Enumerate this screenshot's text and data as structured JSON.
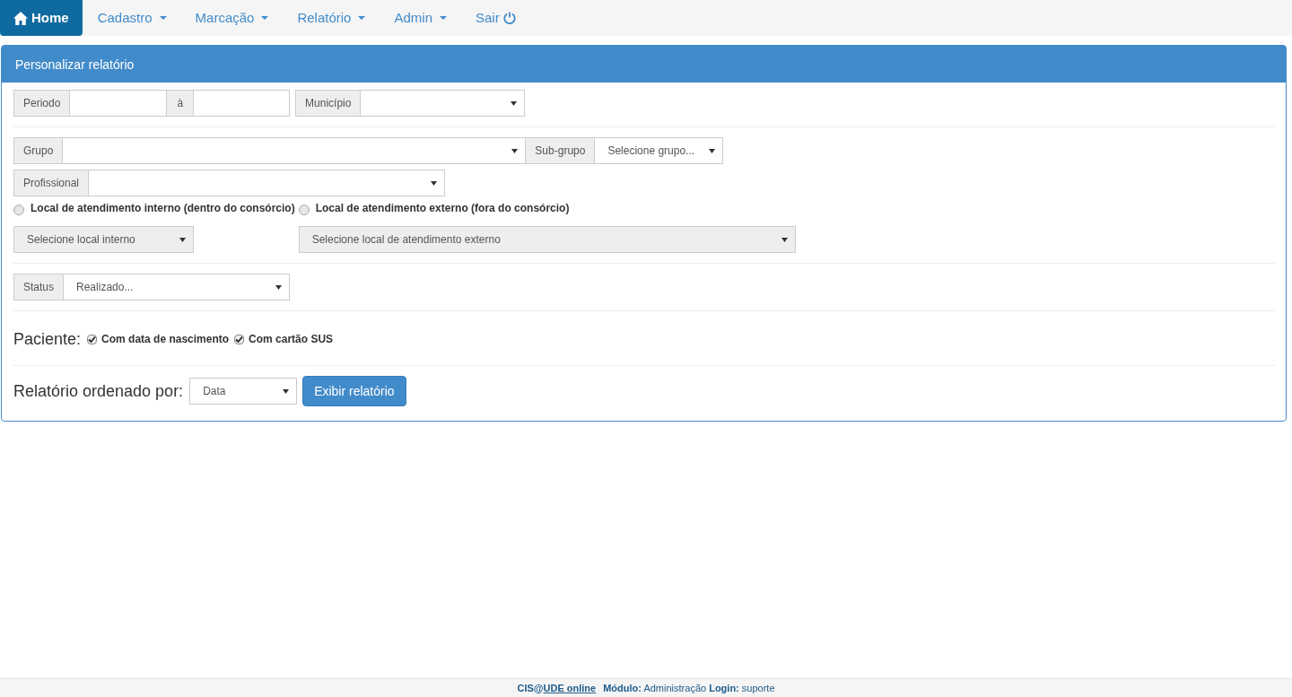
{
  "navbar": {
    "items": [
      {
        "label": "Home",
        "kind": "home",
        "selected": true
      },
      {
        "label": "Cadastro",
        "kind": "menu",
        "selected": false
      },
      {
        "label": "Marcação",
        "kind": "menu",
        "selected": false
      },
      {
        "label": "Relatório",
        "kind": "menu",
        "selected": false
      },
      {
        "label": "Admin",
        "kind": "menu",
        "selected": false
      },
      {
        "label": "Sair",
        "kind": "exit",
        "selected": false
      }
    ]
  },
  "panel": {
    "title": "Personalizar relatório",
    "periodo": {
      "label": "Periodo",
      "separator": "à"
    },
    "municipio": {
      "label": "Município"
    },
    "grupo": {
      "label": "Grupo"
    },
    "subgrupo": {
      "label": "Sub-grupo",
      "value": "Selecione grupo..."
    },
    "profissional": {
      "label": "Profissional"
    },
    "locais": [
      {
        "label": "Local de atendimento interno (dentro do consórcio)",
        "selected": false,
        "select": {
          "value": "Selecione local interno",
          "disabled": true
        }
      },
      {
        "label": "Local de atendimento externo (fora do consórcio)",
        "selected": false,
        "select": {
          "value": "Selecione local de atendimento externo",
          "disabled": true
        }
      }
    ],
    "status": {
      "label": "Status",
      "value": "Realizado..."
    },
    "paciente": {
      "label": "Paciente:",
      "options": [
        {
          "label": "Com data de nascimento",
          "checked": true
        },
        {
          "label": "Com cartão SUS",
          "checked": true
        }
      ]
    },
    "ordenacao": {
      "label": "Relatório ordenado por:",
      "value": "Data"
    },
    "submit": "Exibir relatório"
  },
  "footer": {
    "brand_prefix": "CIS@",
    "brand_link": "UDE online",
    "info": "**Módulo:** Administração **Login:** suporte"
  }
}
